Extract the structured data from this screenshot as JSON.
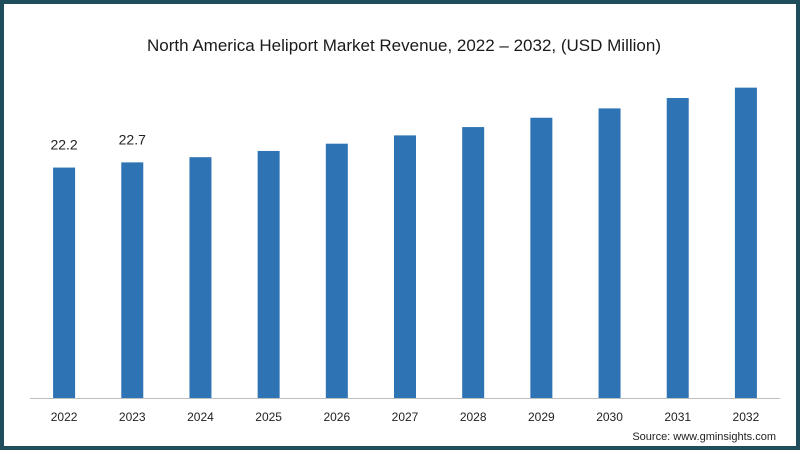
{
  "chart_data": {
    "type": "bar",
    "title": "North America Heliport Market Revenue, 2022 – 2032, (USD Million)",
    "categories": [
      "2022",
      "2023",
      "2024",
      "2025",
      "2026",
      "2027",
      "2028",
      "2029",
      "2030",
      "2031",
      "2032"
    ],
    "values": [
      22.2,
      22.7,
      23.2,
      23.8,
      24.5,
      25.3,
      26.1,
      27.0,
      27.9,
      28.9,
      29.9
    ],
    "data_labels": [
      "22.2",
      "22.7"
    ],
    "xlabel": "",
    "ylabel": "",
    "ylim": [
      0,
      40
    ],
    "grid": false,
    "legend": "none",
    "bar_color": "#2e74b5",
    "baseline_color": "#bfbfbf"
  },
  "source": "Source: www.gminsights.com",
  "frame_color": "#1f4d5c"
}
